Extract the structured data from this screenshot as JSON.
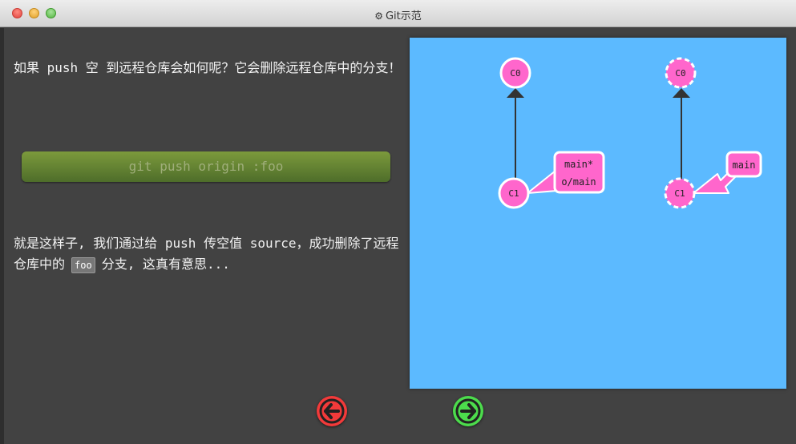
{
  "window": {
    "title": "Git示范",
    "title_icon": "gear-icon"
  },
  "content": {
    "paragraph1": "如果 push 空 到远程仓库会如何呢？它会删除远程仓库中的分支！",
    "command": "git push origin :foo",
    "paragraph2_part1": "就是这样子, 我们通过给 push 传空值 source，成功删除了远程仓库中的",
    "paragraph2_code": "foo",
    "paragraph2_part2": "分支, 这真有意思..."
  },
  "visualization": {
    "local": {
      "commits": [
        {
          "id": "C0"
        },
        {
          "id": "C1"
        }
      ],
      "branch_label_lines": [
        "main*",
        "o/main"
      ]
    },
    "remote": {
      "commits": [
        {
          "id": "C0"
        },
        {
          "id": "C1"
        }
      ],
      "branch_label_lines": [
        "main"
      ]
    }
  },
  "colors": {
    "commit_fill": "#ff66cc",
    "canvas_bg": "#5cbaff",
    "command_bg": "#6b8a36",
    "back_button": "#f23a3a",
    "forward_button": "#4cdc4c"
  },
  "navigation": {
    "back_icon": "arrow-left-icon",
    "forward_icon": "arrow-right-icon"
  }
}
